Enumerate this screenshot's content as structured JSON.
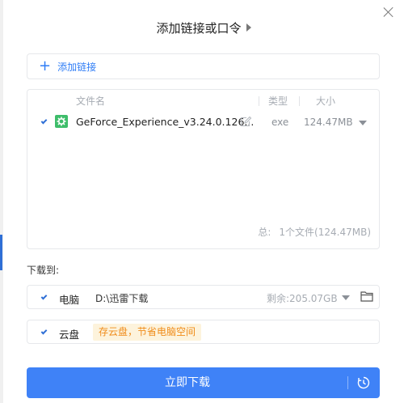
{
  "dialog": {
    "title": "添加链接或口令"
  },
  "add_link": {
    "label": "添加链接"
  },
  "file_list": {
    "headers": {
      "name": "文件名",
      "type": "类型",
      "size": "大小"
    },
    "files": [
      {
        "checked": true,
        "name": "GeForce_Experience_v3.24.0.126...",
        "type": "exe",
        "size": "124.47MB"
      }
    ],
    "summary": {
      "total_label": "总:",
      "total_value": "1个文件(124.47MB)"
    }
  },
  "download_to": {
    "label": "下载到:",
    "computer": {
      "checked": true,
      "name": "电脑",
      "path": "D:\\迅雷下载",
      "remaining": "剩余:205.07GB"
    },
    "cloud": {
      "checked": true,
      "name": "云盘",
      "tip": "存云盘，节省电脑空间"
    }
  },
  "actions": {
    "download_label": "立即下载"
  },
  "colors": {
    "accent": "#3f82f7",
    "link": "#2f7df6",
    "tip_bg": "#fdf3dc",
    "tip_text": "#f08c1a",
    "file_icon": "#3ebd6a"
  },
  "icons": {
    "close": "close-icon",
    "add": "plus-icon",
    "file": "gear-file-icon",
    "edit": "edit-icon",
    "folder": "folder-icon",
    "history": "clock-icon"
  }
}
